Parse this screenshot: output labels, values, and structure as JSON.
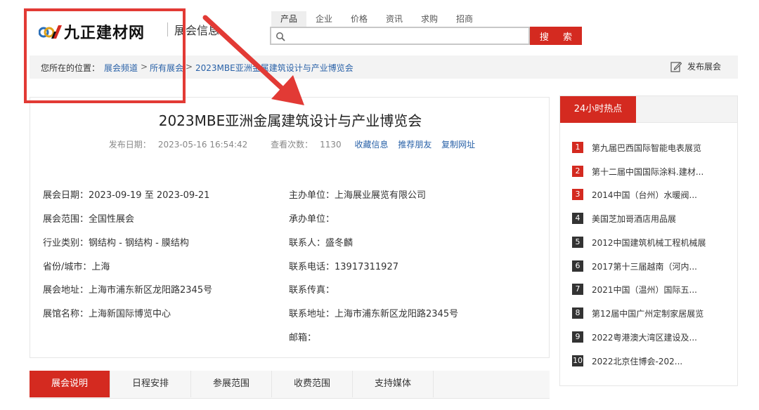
{
  "header": {
    "logo_text": "九正建材网",
    "section_title": "展会信息",
    "search_tabs": [
      "产品",
      "企业",
      "价格",
      "资讯",
      "求购",
      "招商"
    ],
    "search_placeholder": "",
    "search_button": "搜 索"
  },
  "breadcrumb": {
    "label": "您所在的位置：",
    "items": [
      "展会频道",
      "所有展会",
      "2023MBE亚洲金属建筑设计与产业博览会"
    ],
    "sep": ">",
    "publish": "发布展会"
  },
  "exhibition": {
    "title": "2023MBE亚洲金属建筑设计与产业博览会",
    "publish_date_label": "发布日期：",
    "publish_date": "2023-05-16 16:54:42",
    "views_label": "查看次数：",
    "views": "1130",
    "actions": [
      "收藏信息",
      "推荐朋友",
      "复制网址"
    ],
    "left_fields": [
      {
        "label": "展会日期：",
        "value": "2023-09-19 至 2023-09-21"
      },
      {
        "label": "展会范围：",
        "value": "全国性展会"
      },
      {
        "label": "行业类别：",
        "value": "钢结构 - 钢结构 - 膜结构"
      },
      {
        "label": "省份/城市：",
        "value": "上海"
      },
      {
        "label": "展会地址：",
        "value": "上海市浦东新区龙阳路2345号"
      },
      {
        "label": "展馆名称：",
        "value": "上海新国际博览中心"
      }
    ],
    "right_fields": [
      {
        "label": "主办单位：",
        "value": "上海展业展览有限公司"
      },
      {
        "label": "承办单位：",
        "value": ""
      },
      {
        "label": "联系人：",
        "value": "盛冬麟"
      },
      {
        "label": "联系电话：",
        "value": "13917311927"
      },
      {
        "label": "联系传真：",
        "value": ""
      },
      {
        "label": "联系地址：",
        "value": "上海市浦东新区龙阳路2345号"
      },
      {
        "label": "邮箱：",
        "value": ""
      }
    ]
  },
  "detail_tabs": [
    "展会说明",
    "日程安排",
    "参展范围",
    "收费范围",
    "支持媒体"
  ],
  "hot": {
    "title": "24小时热点",
    "items": [
      {
        "num": "1",
        "text": "第九届巴西国际智能电表展览"
      },
      {
        "num": "2",
        "text": "第十二届中国国际涂料.建材..."
      },
      {
        "num": "3",
        "text": "2014中国（台州）水暖阀..."
      },
      {
        "num": "4",
        "text": "美国芝加哥酒店用品展"
      },
      {
        "num": "5",
        "text": "2012中国建筑机械工程机械展"
      },
      {
        "num": "6",
        "text": "2017第十三届越南（河内..."
      },
      {
        "num": "7",
        "text": "2021中国（温州）国际五..."
      },
      {
        "num": "8",
        "text": "第12届中国广州定制家居展览"
      },
      {
        "num": "9",
        "text": "2022粤港澳大湾区建设及..."
      },
      {
        "num": "10",
        "text": "2022北京住博会-202..."
      }
    ]
  },
  "colors": {
    "accent_red": "#d42a20",
    "link_blue": "#2a62a8",
    "annotation_red": "#e23a35"
  }
}
